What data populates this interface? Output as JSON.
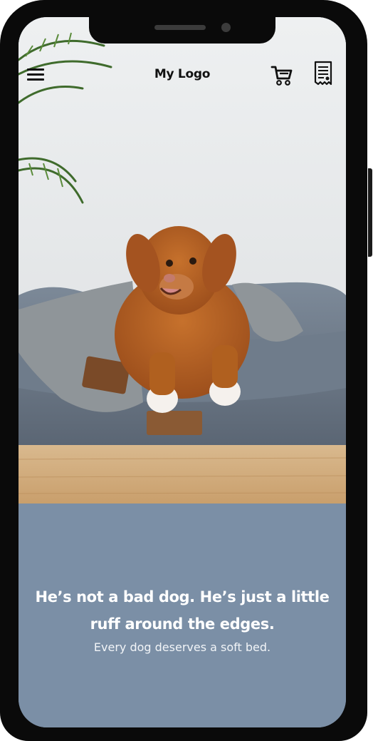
{
  "header": {
    "logo": "My Logo",
    "menu_icon": "hamburger-menu-icon",
    "cart_icon": "shopping-cart-icon",
    "receipt_icon": "receipt-icon"
  },
  "hero": {
    "image_subject": "dog-in-bed-photo"
  },
  "content": {
    "headline": "He’s not a bad dog. He’s just a little ruff around the edges.",
    "subheadline": "Every dog deserves a soft bed."
  },
  "colors": {
    "panel": "#7b8fa6",
    "text": "#ffffff",
    "frame": "#0a0a0a"
  }
}
